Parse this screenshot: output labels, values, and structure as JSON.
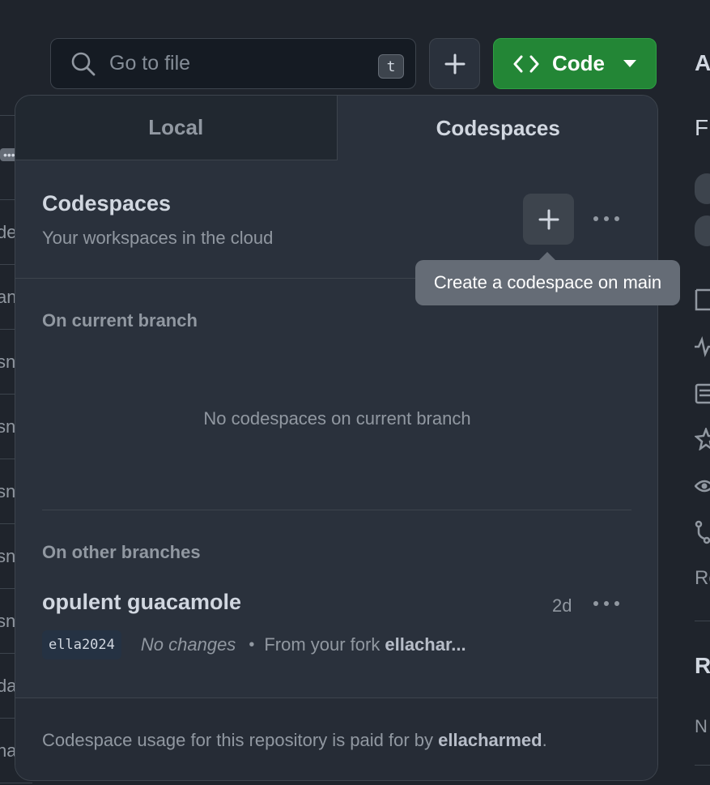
{
  "toolbar": {
    "search_placeholder": "Go to file",
    "search_shortcut": "t",
    "code_label": "Code"
  },
  "dropdown": {
    "tabs": [
      {
        "label": "Local",
        "active": false
      },
      {
        "label": "Codespaces",
        "active": true
      }
    ],
    "header": {
      "title": "Codespaces",
      "subtitle": "Your workspaces in the cloud"
    },
    "tooltip": "Create a codespace on main",
    "current_branch": {
      "label": "On current branch",
      "empty_message": "No codespaces on current branch"
    },
    "other_branches": {
      "label": "On other branches",
      "items": [
        {
          "name": "opulent guacamole",
          "age": "2d",
          "branch": "ella2024",
          "changes": "No changes",
          "separator": "•",
          "origin_prefix": "From your fork",
          "origin_name": "ellachar..."
        }
      ]
    },
    "footer": {
      "prefix": "Codespace usage for this repository is paid for by",
      "payer": "ellacharmed",
      "suffix": "."
    }
  },
  "background": {
    "file_fragments": [
      "de",
      "an",
      "sn",
      "sn",
      "sn",
      "sn",
      "sn",
      "da",
      "ha"
    ],
    "right_fragments": [
      "A",
      "Fr",
      "Re",
      "R",
      "N"
    ]
  },
  "colors": {
    "primary_button": "#238636",
    "panel_bg": "#2a313c",
    "tooltip_bg": "#656c76"
  },
  "icons": {
    "search": "search-icon",
    "plus": "plus-icon",
    "code": "code-icon",
    "caret": "triangle-down-icon",
    "more": "kebab-horizontal-icon"
  }
}
